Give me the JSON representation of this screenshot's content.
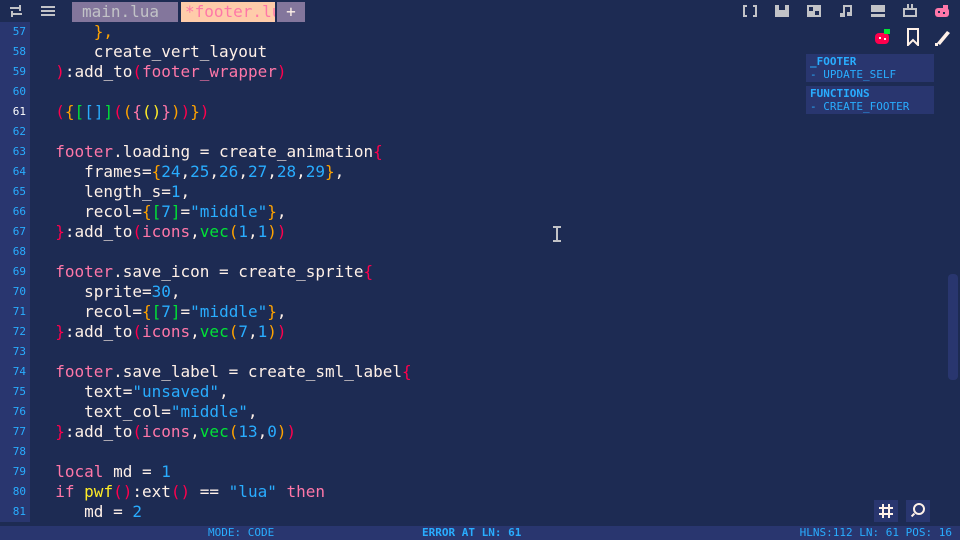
{
  "topbar": {
    "tabs": [
      {
        "label": "main.lua",
        "active": false
      },
      {
        "label": "*footer.lua",
        "active": true
      }
    ],
    "add_tab": "+"
  },
  "toolbar_icons": [
    "brackets-icon",
    "chip-icon",
    "sprite-icon",
    "music-icon",
    "sfx-icon",
    "tv-icon",
    "strawberry-icon"
  ],
  "editor": {
    "current_line": 61,
    "lines": [
      {
        "n": 57,
        "t": [
          [
            "      ",
            "txt"
          ],
          [
            "},",
            "cb"
          ]
        ]
      },
      {
        "n": 58,
        "t": [
          [
            "      create_vert_layout",
            "txt"
          ]
        ]
      },
      {
        "n": 59,
        "t": [
          [
            "  ",
            "txt"
          ],
          [
            ")",
            "br"
          ],
          [
            ":add_to",
            "txt"
          ],
          [
            "(",
            "br"
          ],
          [
            "footer_wrapper",
            "kw"
          ],
          [
            ")",
            "br"
          ]
        ]
      },
      {
        "n": 60,
        "t": []
      },
      {
        "n": 61,
        "t": [
          [
            "  ",
            "txt"
          ],
          [
            "(",
            "br"
          ],
          [
            "{",
            "cb"
          ],
          [
            "[",
            "grn"
          ],
          [
            "[",
            "num"
          ],
          [
            "]",
            "num"
          ],
          [
            "]",
            "grn"
          ],
          [
            "(",
            "br"
          ],
          [
            "(",
            "cb"
          ],
          [
            "{",
            "pnk"
          ],
          [
            "(",
            "yel"
          ],
          [
            ")",
            "yel"
          ],
          [
            "}",
            "pnk"
          ],
          [
            ")",
            "cb"
          ],
          [
            ")",
            "br"
          ],
          [
            "}",
            "cb"
          ],
          [
            ")",
            "br"
          ]
        ]
      },
      {
        "n": 62,
        "t": []
      },
      {
        "n": 63,
        "t": [
          [
            "  ",
            "txt"
          ],
          [
            "footer",
            "kw"
          ],
          [
            ".loading = create_animation",
            "txt"
          ],
          [
            "{",
            "br"
          ]
        ]
      },
      {
        "n": 64,
        "t": [
          [
            "     frames=",
            "txt"
          ],
          [
            "{",
            "cb"
          ],
          [
            "24",
            "num"
          ],
          [
            ",",
            "txt"
          ],
          [
            "25",
            "num"
          ],
          [
            ",",
            "txt"
          ],
          [
            "26",
            "num"
          ],
          [
            ",",
            "txt"
          ],
          [
            "27",
            "num"
          ],
          [
            ",",
            "txt"
          ],
          [
            "28",
            "num"
          ],
          [
            ",",
            "txt"
          ],
          [
            "29",
            "num"
          ],
          [
            "}",
            "cb"
          ],
          [
            ",",
            "txt"
          ]
        ]
      },
      {
        "n": 65,
        "t": [
          [
            "     length_s=",
            "txt"
          ],
          [
            "1",
            "num"
          ],
          [
            ",",
            "txt"
          ]
        ]
      },
      {
        "n": 66,
        "t": [
          [
            "     recol=",
            "txt"
          ],
          [
            "{",
            "cb"
          ],
          [
            "[",
            "grn"
          ],
          [
            "7",
            "num"
          ],
          [
            "]",
            "grn"
          ],
          [
            "=",
            "txt"
          ],
          [
            "\"middle\"",
            "str"
          ],
          [
            "}",
            "cb"
          ],
          [
            ",",
            "txt"
          ]
        ]
      },
      {
        "n": 67,
        "t": [
          [
            "  ",
            "txt"
          ],
          [
            "}",
            "br"
          ],
          [
            ":add_to",
            "txt"
          ],
          [
            "(",
            "br"
          ],
          [
            "icons",
            "kw"
          ],
          [
            ",",
            "txt"
          ],
          [
            "vec",
            "grn"
          ],
          [
            "(",
            "cb"
          ],
          [
            "1",
            "num"
          ],
          [
            ",",
            "txt"
          ],
          [
            "1",
            "num"
          ],
          [
            ")",
            "cb"
          ],
          [
            ")",
            "br"
          ]
        ]
      },
      {
        "n": 68,
        "t": []
      },
      {
        "n": 69,
        "t": [
          [
            "  ",
            "txt"
          ],
          [
            "footer",
            "kw"
          ],
          [
            ".save_icon = create_sprite",
            "txt"
          ],
          [
            "{",
            "br"
          ]
        ]
      },
      {
        "n": 70,
        "t": [
          [
            "     sprite=",
            "txt"
          ],
          [
            "30",
            "num"
          ],
          [
            ",",
            "txt"
          ]
        ]
      },
      {
        "n": 71,
        "t": [
          [
            "     recol=",
            "txt"
          ],
          [
            "{",
            "cb"
          ],
          [
            "[",
            "grn"
          ],
          [
            "7",
            "num"
          ],
          [
            "]",
            "grn"
          ],
          [
            "=",
            "txt"
          ],
          [
            "\"middle\"",
            "str"
          ],
          [
            "}",
            "cb"
          ],
          [
            ",",
            "txt"
          ]
        ]
      },
      {
        "n": 72,
        "t": [
          [
            "  ",
            "txt"
          ],
          [
            "}",
            "br"
          ],
          [
            ":add_to",
            "txt"
          ],
          [
            "(",
            "br"
          ],
          [
            "icons",
            "kw"
          ],
          [
            ",",
            "txt"
          ],
          [
            "vec",
            "grn"
          ],
          [
            "(",
            "cb"
          ],
          [
            "7",
            "num"
          ],
          [
            ",",
            "txt"
          ],
          [
            "1",
            "num"
          ],
          [
            ")",
            "cb"
          ],
          [
            ")",
            "br"
          ]
        ]
      },
      {
        "n": 73,
        "t": []
      },
      {
        "n": 74,
        "t": [
          [
            "  ",
            "txt"
          ],
          [
            "footer",
            "kw"
          ],
          [
            ".save_label = create_sml_label",
            "txt"
          ],
          [
            "{",
            "br"
          ]
        ]
      },
      {
        "n": 75,
        "t": [
          [
            "     text=",
            "txt"
          ],
          [
            "\"unsaved\"",
            "str"
          ],
          [
            ",",
            "txt"
          ]
        ]
      },
      {
        "n": 76,
        "t": [
          [
            "     text_col=",
            "txt"
          ],
          [
            "\"middle\"",
            "str"
          ],
          [
            ",",
            "txt"
          ]
        ]
      },
      {
        "n": 77,
        "t": [
          [
            "  ",
            "txt"
          ],
          [
            "}",
            "br"
          ],
          [
            ":add_to",
            "txt"
          ],
          [
            "(",
            "br"
          ],
          [
            "icons",
            "kw"
          ],
          [
            ",",
            "txt"
          ],
          [
            "vec",
            "grn"
          ],
          [
            "(",
            "cb"
          ],
          [
            "13",
            "num"
          ],
          [
            ",",
            "txt"
          ],
          [
            "0",
            "num"
          ],
          [
            ")",
            "cb"
          ],
          [
            ")",
            "br"
          ]
        ]
      },
      {
        "n": 78,
        "t": []
      },
      {
        "n": 79,
        "t": [
          [
            "  ",
            "txt"
          ],
          [
            "local",
            "kw"
          ],
          [
            " md = ",
            "txt"
          ],
          [
            "1",
            "num"
          ]
        ]
      },
      {
        "n": 80,
        "t": [
          [
            "  ",
            "txt"
          ],
          [
            "if",
            "kw"
          ],
          [
            " ",
            "txt"
          ],
          [
            "pwf",
            "yel"
          ],
          [
            "()",
            "br"
          ],
          [
            ":ext",
            "txt"
          ],
          [
            "()",
            "br"
          ],
          [
            " == ",
            "txt"
          ],
          [
            "\"lua\"",
            "str"
          ],
          [
            " ",
            "txt"
          ],
          [
            "then",
            "kw"
          ]
        ]
      },
      {
        "n": 81,
        "t": [
          [
            "     md = ",
            "txt"
          ],
          [
            "2",
            "num"
          ]
        ]
      }
    ]
  },
  "outline": [
    {
      "heading": "_FOOTER",
      "items": [
        "- UPDATE_SELF"
      ]
    },
    {
      "heading": "FUNCTIONS",
      "items": [
        "- CREATE_FOOTER"
      ]
    }
  ],
  "status": {
    "mode": "MODE: CODE",
    "error": "ERROR AT LN: 61",
    "right": "HLNS:112  LN: 61  POS: 16"
  },
  "colors": {
    "bg": "#1d2b53",
    "gutter": "#29366f",
    "accent_pink": "#ff77a8",
    "accent_red": "#ff004d",
    "accent_blue": "#29adff",
    "accent_orange": "#ffa300",
    "accent_green": "#00e436"
  }
}
